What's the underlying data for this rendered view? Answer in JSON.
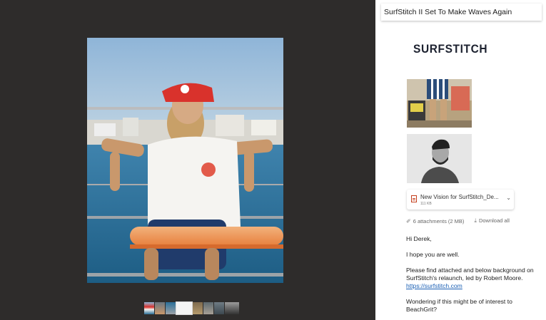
{
  "email": {
    "subject": "SurfStitch II Set To Make Waves Again",
    "logo_text": "SURFSTITCH",
    "attachment": {
      "name": "New Vision for SurfStitch_De...",
      "size": "111 KB"
    },
    "attachments_summary": "6 attachments (2 MB)",
    "download_all": "Download all",
    "body": {
      "greeting": "Hi Derek,",
      "line1": "I hope you are well.",
      "line2": "Please find attached and below background on SurfStitch's relaunch, led by Robert Moore.",
      "link": "https://surfstitch.com",
      "line3": "Wondering if this might be of interest to BeachGrit?"
    }
  },
  "viewer": {
    "thumbnail_count": 8
  },
  "icons": {
    "attachment_doc": "word-doc-icon",
    "expand": "chevron-down-icon",
    "attachments": "paperclip-icon",
    "download": "download-icon"
  }
}
